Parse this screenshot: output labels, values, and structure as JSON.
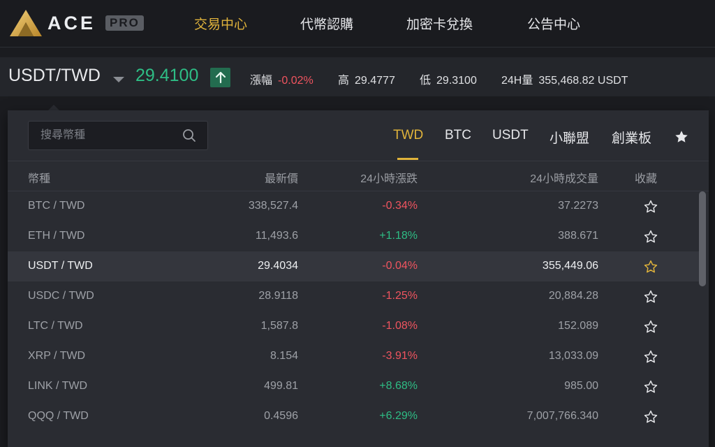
{
  "brand": {
    "word": "ACE",
    "badge": "PRO"
  },
  "nav": [
    {
      "label": "交易中心",
      "active": true
    },
    {
      "label": "代幣認購",
      "active": false
    },
    {
      "label": "加密卡兌換",
      "active": false
    },
    {
      "label": "公告中心",
      "active": false
    }
  ],
  "ticker": {
    "pair": "USDT/TWD",
    "last_price": "29.4100",
    "change_label": "漲幅",
    "change_value": "-0.02%",
    "high_label": "高",
    "high_value": "29.4777",
    "low_label": "低",
    "low_value": "29.3100",
    "volume_label": "24H量",
    "volume_value": "355,468.82 USDT"
  },
  "market_panel": {
    "search_placeholder": "搜尋幣種",
    "tabs": [
      {
        "label": "TWD",
        "active": true
      },
      {
        "label": "BTC",
        "active": false
      },
      {
        "label": "USDT",
        "active": false
      },
      {
        "label": "小聯盟",
        "active": false
      },
      {
        "label": "創業板",
        "active": false
      }
    ],
    "columns": {
      "coin": "幣種",
      "price": "最新價",
      "change": "24小時漲跌",
      "volume": "24小時成交量",
      "favorite": "收藏"
    },
    "rows": [
      {
        "pair": "BTC / TWD",
        "price": "338,527.4",
        "change": "-0.34%",
        "volume": "37.2273",
        "favorite": false,
        "selected": false
      },
      {
        "pair": "ETH / TWD",
        "price": "11,493.6",
        "change": "+1.18%",
        "volume": "388.671",
        "favorite": false,
        "selected": false
      },
      {
        "pair": "USDT / TWD",
        "price": "29.4034",
        "change": "-0.04%",
        "volume": "355,449.06",
        "favorite": true,
        "selected": true
      },
      {
        "pair": "USDC / TWD",
        "price": "28.9118",
        "change": "-1.25%",
        "volume": "20,884.28",
        "favorite": false,
        "selected": false
      },
      {
        "pair": "LTC / TWD",
        "price": "1,587.8",
        "change": "-1.08%",
        "volume": "152.089",
        "favorite": false,
        "selected": false
      },
      {
        "pair": "XRP / TWD",
        "price": "8.154",
        "change": "-3.91%",
        "volume": "13,033.09",
        "favorite": false,
        "selected": false
      },
      {
        "pair": "LINK / TWD",
        "price": "499.81",
        "change": "+8.68%",
        "volume": "985.00",
        "favorite": false,
        "selected": false
      },
      {
        "pair": "QQQ / TWD",
        "price": "0.4596",
        "change": "+6.29%",
        "volume": "7,007,766.340",
        "favorite": false,
        "selected": false
      }
    ]
  },
  "colors": {
    "accent": "#e0b33b",
    "up": "#2ebd85",
    "down": "#f0545f",
    "background": "#1b1c20",
    "panel": "#2a2c32"
  },
  "icons": {
    "logo": "ace-triangle-logo",
    "caret": "caret-down-icon",
    "up_arrow": "arrow-up-icon",
    "search": "search-icon",
    "favorite_tab": "star-filled-icon",
    "favorite_row": "star-outline-icon"
  }
}
